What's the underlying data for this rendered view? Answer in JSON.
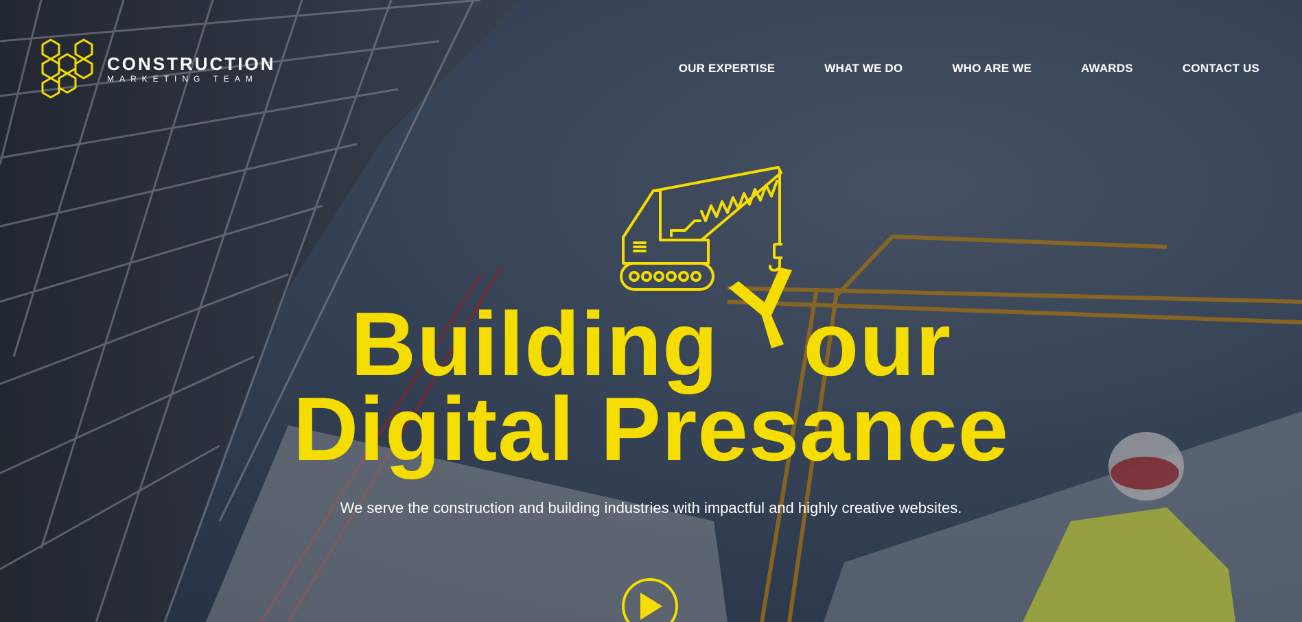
{
  "brand": {
    "title": "CONSTRUCTION",
    "subtitle": "MARKETING TEAM",
    "icon": "cube-cluster-logo-icon"
  },
  "nav": {
    "items": [
      {
        "label": "OUR EXPERTISE"
      },
      {
        "label": "WHAT WE DO"
      },
      {
        "label": "WHO ARE WE"
      },
      {
        "label": "AWARDS"
      },
      {
        "label": "CONTACT US"
      }
    ]
  },
  "hero": {
    "headline_line1_part1": "Building",
    "headline_line1_y": "Y",
    "headline_line1_part2": "our",
    "headline_line2": "Digital Presance",
    "tagline": "We serve the construction and building industries with impactful and highly creative websites.",
    "icons": [
      "crane-icon",
      "play-icon"
    ]
  },
  "colors": {
    "accent": "#f5dd00",
    "text": "#ffffff",
    "background": "#3c4a5e"
  }
}
